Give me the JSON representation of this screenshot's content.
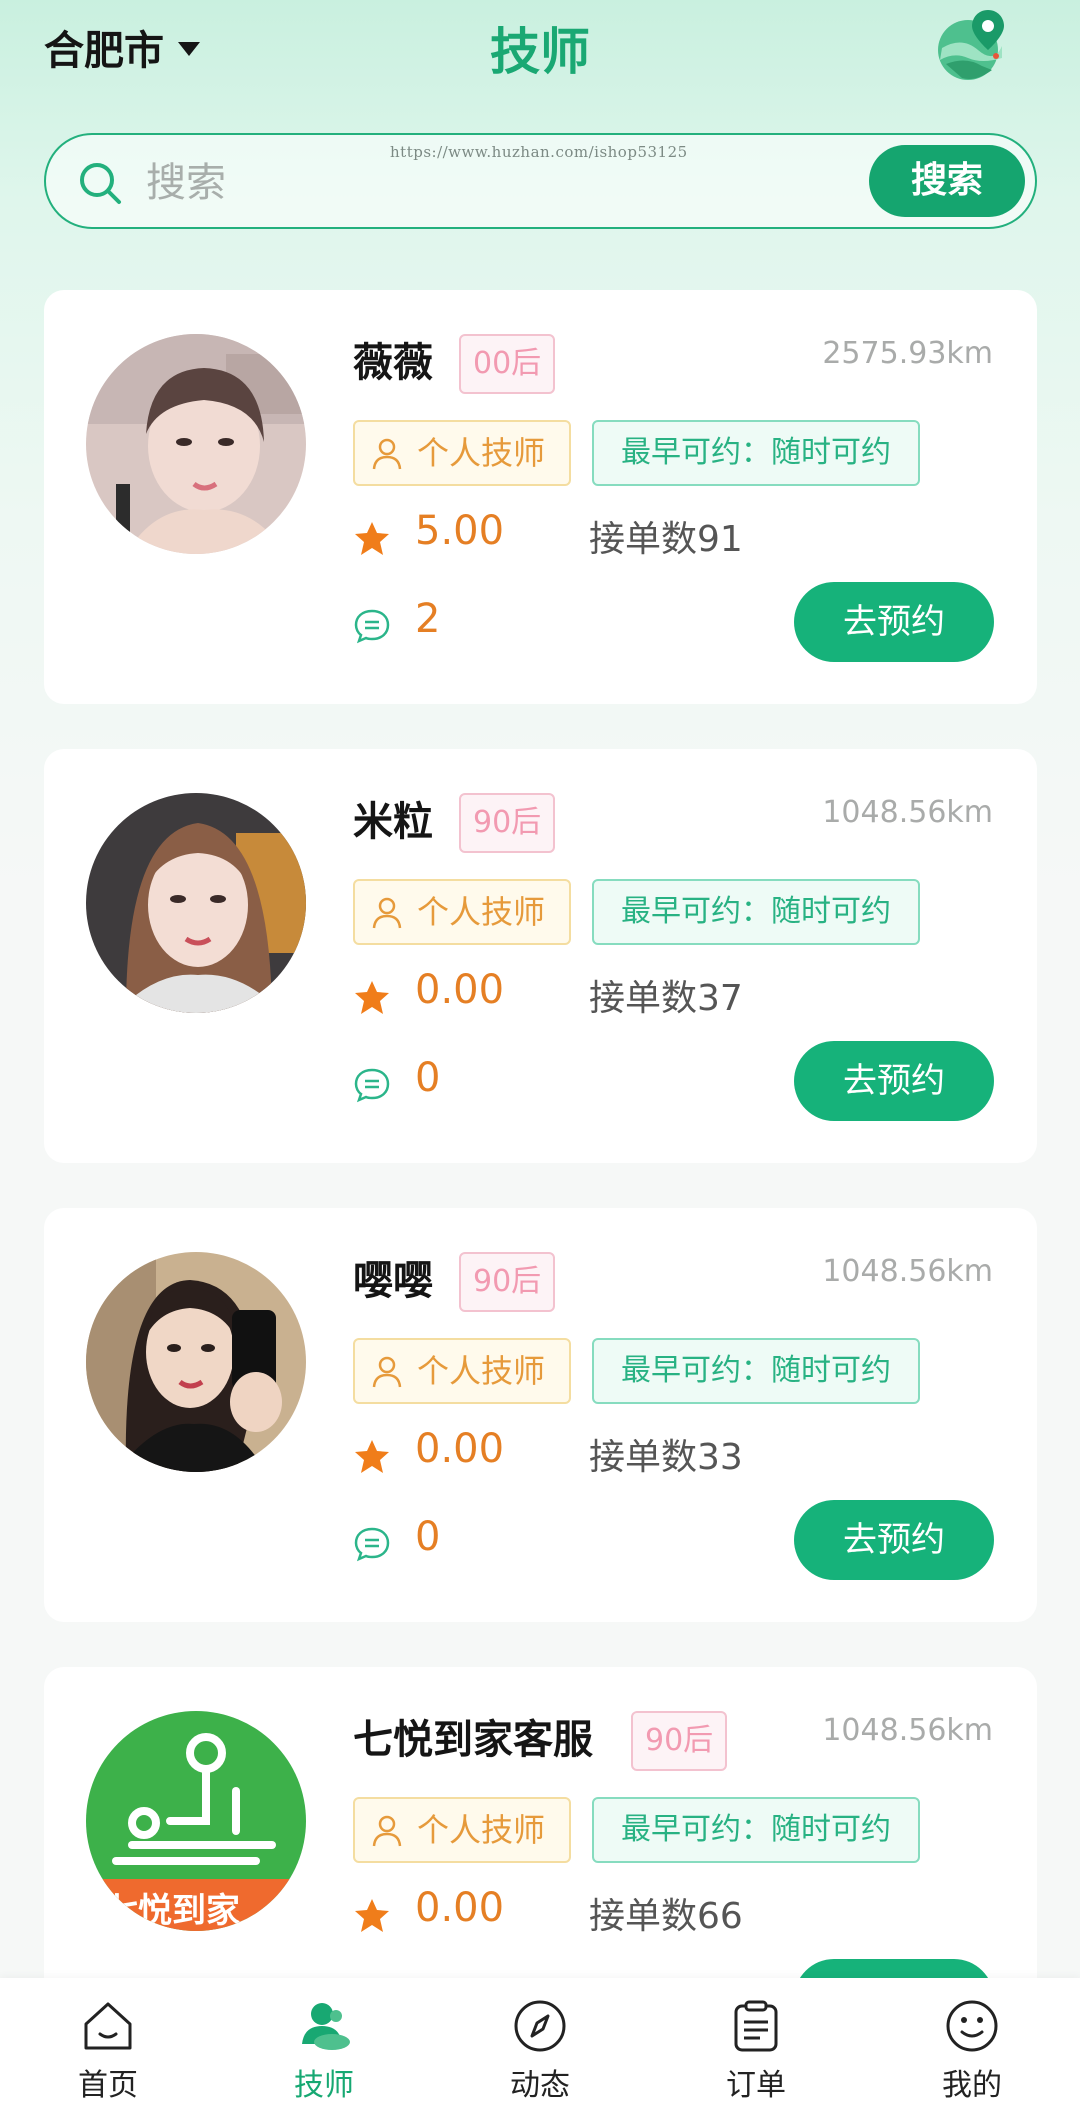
{
  "header": {
    "city": "合肥市",
    "title": "技师",
    "watermark": "https://www.huzhan.com/ishop53125"
  },
  "search": {
    "placeholder": "搜索",
    "button_label": "搜索"
  },
  "cards": [
    {
      "name": "薇薇",
      "age_tag": "00后",
      "distance": "2575.93km",
      "type_tag": "个人技师",
      "availability": "最早可约：随时可约",
      "rating": "5.00",
      "orders": "接单数91",
      "comments": "2",
      "book_label": "去预约"
    },
    {
      "name": "米粒",
      "age_tag": "90后",
      "distance": "1048.56km",
      "type_tag": "个人技师",
      "availability": "最早可约：随时可约",
      "rating": "0.00",
      "orders": "接单数37",
      "comments": "0",
      "book_label": "去预约"
    },
    {
      "name": "嘤嘤",
      "age_tag": "90后",
      "distance": "1048.56km",
      "type_tag": "个人技师",
      "availability": "最早可约：随时可约",
      "rating": "0.00",
      "orders": "接单数33",
      "comments": "0",
      "book_label": "去预约"
    },
    {
      "name": "七悦到家客服",
      "age_tag": "90后",
      "distance": "1048.56km",
      "type_tag": "个人技师",
      "availability": "最早可约：随时可约",
      "rating": "0.00",
      "orders": "接单数66",
      "avatar_text": "七悦到家"
    }
  ],
  "tabbar": {
    "items": [
      {
        "label": "首页",
        "icon": "home-icon"
      },
      {
        "label": "技师",
        "icon": "technician-icon",
        "active": true
      },
      {
        "label": "动态",
        "icon": "compass-icon"
      },
      {
        "label": "订单",
        "icon": "clipboard-icon"
      },
      {
        "label": "我的",
        "icon": "smiley-icon"
      }
    ]
  },
  "colors": {
    "brand_green": "#16b27a",
    "rating_orange": "#e57f24",
    "age_pink": "#f29ab1",
    "personal_tag_amber": "#e69a3b"
  }
}
